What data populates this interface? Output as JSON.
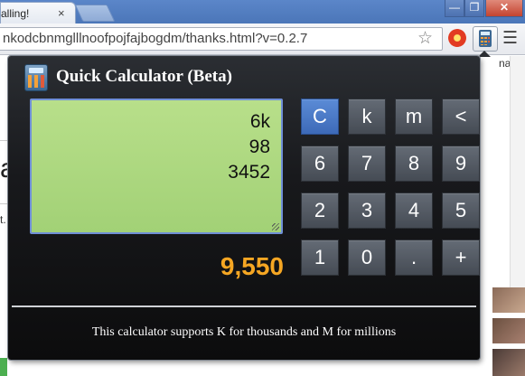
{
  "browser": {
    "tab_title": "alling!",
    "tab_close": "×",
    "url": "nkodcbnmglllnoofpojfajbogdm/thanks.html?v=0.2.7",
    "window_min": "—",
    "window_max": "❐",
    "window_close": "✕"
  },
  "background_page": {
    "letter": "a",
    "text_t": "t.",
    "right_text": "nake"
  },
  "calculator": {
    "title": "Quick Calculator (Beta)",
    "display_lines": [
      "6k",
      "98",
      "3452"
    ],
    "result": "9,550",
    "keys": {
      "clear": "C",
      "thousand": "k",
      "million": "m",
      "backspace": "<",
      "six": "6",
      "seven": "7",
      "eight": "8",
      "nine": "9",
      "two": "2",
      "three": "3",
      "four": "4",
      "five": "5",
      "one": "1",
      "zero": "0",
      "decimal": ".",
      "plus": "+"
    },
    "footer": "This calculator supports K for thousands and M for millions",
    "active_key_color": "#4a7bc8",
    "result_color": "#f5a623"
  }
}
